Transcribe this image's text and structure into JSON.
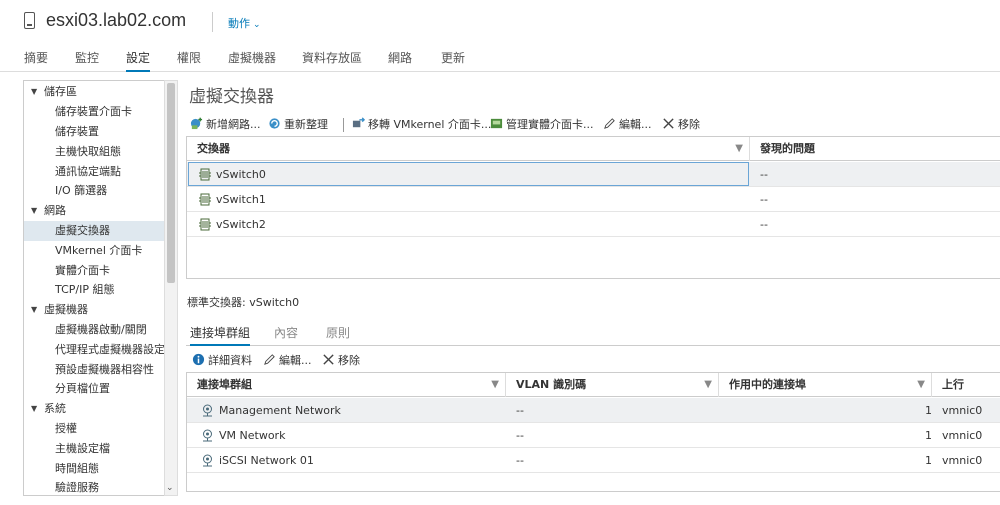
{
  "header": {
    "host": "esxi03.lab02.com",
    "actions_label": "動作",
    "actions_chevron": "⌄"
  },
  "tabs": [
    {
      "label": "摘要"
    },
    {
      "label": "監控"
    },
    {
      "label": "設定",
      "active": true
    },
    {
      "label": "權限"
    },
    {
      "label": "虛擬機器"
    },
    {
      "label": "資料存放區"
    },
    {
      "label": "網路"
    },
    {
      "label": "更新"
    }
  ],
  "sidebar": {
    "items": [
      {
        "label": "儲存區",
        "type": "group"
      },
      {
        "label": "儲存裝置介面卡",
        "type": "child"
      },
      {
        "label": "儲存裝置",
        "type": "child"
      },
      {
        "label": "主機快取組態",
        "type": "child"
      },
      {
        "label": "通訊協定端點",
        "type": "child"
      },
      {
        "label": "I/O 篩選器",
        "type": "child"
      },
      {
        "label": "網路",
        "type": "group"
      },
      {
        "label": "虛擬交換器",
        "type": "child",
        "selected": true
      },
      {
        "label": "VMkernel 介面卡",
        "type": "child"
      },
      {
        "label": "實體介面卡",
        "type": "child"
      },
      {
        "label": "TCP/IP 組態",
        "type": "child"
      },
      {
        "label": "虛擬機器",
        "type": "group"
      },
      {
        "label": "虛擬機器啟動/關閉",
        "type": "child"
      },
      {
        "label": "代理程式虛擬機器設定",
        "type": "child"
      },
      {
        "label": "預設虛擬機器相容性",
        "type": "child"
      },
      {
        "label": "分頁檔位置",
        "type": "child"
      },
      {
        "label": "系統",
        "type": "group"
      },
      {
        "label": "授權",
        "type": "child"
      },
      {
        "label": "主機設定檔",
        "type": "child"
      },
      {
        "label": "時間組態",
        "type": "child"
      },
      {
        "label": "驗證服務",
        "type": "child"
      }
    ]
  },
  "main": {
    "title": "虛擬交換器",
    "toolbar": {
      "add_network": "新增網路...",
      "refresh": "重新整理",
      "migrate_vmk": "移轉 VMkernel 介面卡...",
      "manage_nics": "管理實體介面卡...",
      "edit": "編輯...",
      "remove": "移除"
    },
    "switch_grid": {
      "columns": [
        "交換器",
        "發現的問題"
      ],
      "rows": [
        {
          "name": "vSwitch0",
          "issues": "--"
        },
        {
          "name": "vSwitch1",
          "issues": "--"
        },
        {
          "name": "vSwitch2",
          "issues": "--"
        }
      ]
    },
    "standard_switch_label": "標準交換器: vSwitch0",
    "subtabs": [
      {
        "label": "連接埠群組",
        "active": true
      },
      {
        "label": "內容"
      },
      {
        "label": "原則"
      }
    ],
    "pg_toolbar": {
      "details": "詳細資料",
      "edit": "編輯...",
      "remove": "移除"
    },
    "portgroup_grid": {
      "columns": [
        "連接埠群組",
        "VLAN 識別碼",
        "作用中的連接埠",
        "上行"
      ],
      "rows": [
        {
          "name": "Management Network",
          "vlan": "--",
          "ports": "1",
          "uplink": "vmnic0"
        },
        {
          "name": "VM Network",
          "vlan": "--",
          "ports": "1",
          "uplink": "vmnic0"
        },
        {
          "name": "iSCSI Network 01",
          "vlan": "--",
          "ports": "1",
          "uplink": "vmnic0"
        }
      ]
    }
  },
  "colors": {
    "accent": "#0079b8",
    "selected_bg": "#dfe8ef",
    "row_selected_bg": "#eef0f2"
  }
}
